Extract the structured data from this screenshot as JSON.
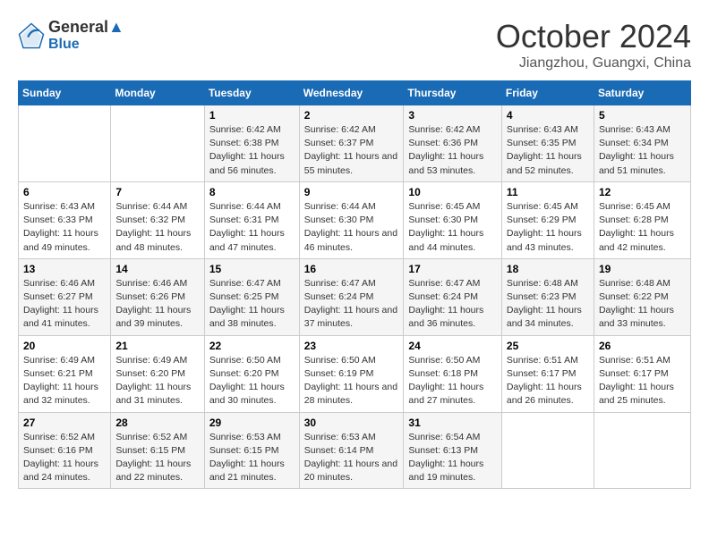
{
  "header": {
    "logo_line1": "General",
    "logo_line2": "Blue",
    "month_title": "October 2024",
    "subtitle": "Jiangzhou, Guangxi, China"
  },
  "days_of_week": [
    "Sunday",
    "Monday",
    "Tuesday",
    "Wednesday",
    "Thursday",
    "Friday",
    "Saturday"
  ],
  "weeks": [
    [
      {
        "day": "",
        "info": ""
      },
      {
        "day": "",
        "info": ""
      },
      {
        "day": "1",
        "info": "Sunrise: 6:42 AM\nSunset: 6:38 PM\nDaylight: 11 hours and 56 minutes."
      },
      {
        "day": "2",
        "info": "Sunrise: 6:42 AM\nSunset: 6:37 PM\nDaylight: 11 hours and 55 minutes."
      },
      {
        "day": "3",
        "info": "Sunrise: 6:42 AM\nSunset: 6:36 PM\nDaylight: 11 hours and 53 minutes."
      },
      {
        "day": "4",
        "info": "Sunrise: 6:43 AM\nSunset: 6:35 PM\nDaylight: 11 hours and 52 minutes."
      },
      {
        "day": "5",
        "info": "Sunrise: 6:43 AM\nSunset: 6:34 PM\nDaylight: 11 hours and 51 minutes."
      }
    ],
    [
      {
        "day": "6",
        "info": "Sunrise: 6:43 AM\nSunset: 6:33 PM\nDaylight: 11 hours and 49 minutes."
      },
      {
        "day": "7",
        "info": "Sunrise: 6:44 AM\nSunset: 6:32 PM\nDaylight: 11 hours and 48 minutes."
      },
      {
        "day": "8",
        "info": "Sunrise: 6:44 AM\nSunset: 6:31 PM\nDaylight: 11 hours and 47 minutes."
      },
      {
        "day": "9",
        "info": "Sunrise: 6:44 AM\nSunset: 6:30 PM\nDaylight: 11 hours and 46 minutes."
      },
      {
        "day": "10",
        "info": "Sunrise: 6:45 AM\nSunset: 6:30 PM\nDaylight: 11 hours and 44 minutes."
      },
      {
        "day": "11",
        "info": "Sunrise: 6:45 AM\nSunset: 6:29 PM\nDaylight: 11 hours and 43 minutes."
      },
      {
        "day": "12",
        "info": "Sunrise: 6:45 AM\nSunset: 6:28 PM\nDaylight: 11 hours and 42 minutes."
      }
    ],
    [
      {
        "day": "13",
        "info": "Sunrise: 6:46 AM\nSunset: 6:27 PM\nDaylight: 11 hours and 41 minutes."
      },
      {
        "day": "14",
        "info": "Sunrise: 6:46 AM\nSunset: 6:26 PM\nDaylight: 11 hours and 39 minutes."
      },
      {
        "day": "15",
        "info": "Sunrise: 6:47 AM\nSunset: 6:25 PM\nDaylight: 11 hours and 38 minutes."
      },
      {
        "day": "16",
        "info": "Sunrise: 6:47 AM\nSunset: 6:24 PM\nDaylight: 11 hours and 37 minutes."
      },
      {
        "day": "17",
        "info": "Sunrise: 6:47 AM\nSunset: 6:24 PM\nDaylight: 11 hours and 36 minutes."
      },
      {
        "day": "18",
        "info": "Sunrise: 6:48 AM\nSunset: 6:23 PM\nDaylight: 11 hours and 34 minutes."
      },
      {
        "day": "19",
        "info": "Sunrise: 6:48 AM\nSunset: 6:22 PM\nDaylight: 11 hours and 33 minutes."
      }
    ],
    [
      {
        "day": "20",
        "info": "Sunrise: 6:49 AM\nSunset: 6:21 PM\nDaylight: 11 hours and 32 minutes."
      },
      {
        "day": "21",
        "info": "Sunrise: 6:49 AM\nSunset: 6:20 PM\nDaylight: 11 hours and 31 minutes."
      },
      {
        "day": "22",
        "info": "Sunrise: 6:50 AM\nSunset: 6:20 PM\nDaylight: 11 hours and 30 minutes."
      },
      {
        "day": "23",
        "info": "Sunrise: 6:50 AM\nSunset: 6:19 PM\nDaylight: 11 hours and 28 minutes."
      },
      {
        "day": "24",
        "info": "Sunrise: 6:50 AM\nSunset: 6:18 PM\nDaylight: 11 hours and 27 minutes."
      },
      {
        "day": "25",
        "info": "Sunrise: 6:51 AM\nSunset: 6:17 PM\nDaylight: 11 hours and 26 minutes."
      },
      {
        "day": "26",
        "info": "Sunrise: 6:51 AM\nSunset: 6:17 PM\nDaylight: 11 hours and 25 minutes."
      }
    ],
    [
      {
        "day": "27",
        "info": "Sunrise: 6:52 AM\nSunset: 6:16 PM\nDaylight: 11 hours and 24 minutes."
      },
      {
        "day": "28",
        "info": "Sunrise: 6:52 AM\nSunset: 6:15 PM\nDaylight: 11 hours and 22 minutes."
      },
      {
        "day": "29",
        "info": "Sunrise: 6:53 AM\nSunset: 6:15 PM\nDaylight: 11 hours and 21 minutes."
      },
      {
        "day": "30",
        "info": "Sunrise: 6:53 AM\nSunset: 6:14 PM\nDaylight: 11 hours and 20 minutes."
      },
      {
        "day": "31",
        "info": "Sunrise: 6:54 AM\nSunset: 6:13 PM\nDaylight: 11 hours and 19 minutes."
      },
      {
        "day": "",
        "info": ""
      },
      {
        "day": "",
        "info": ""
      }
    ]
  ]
}
